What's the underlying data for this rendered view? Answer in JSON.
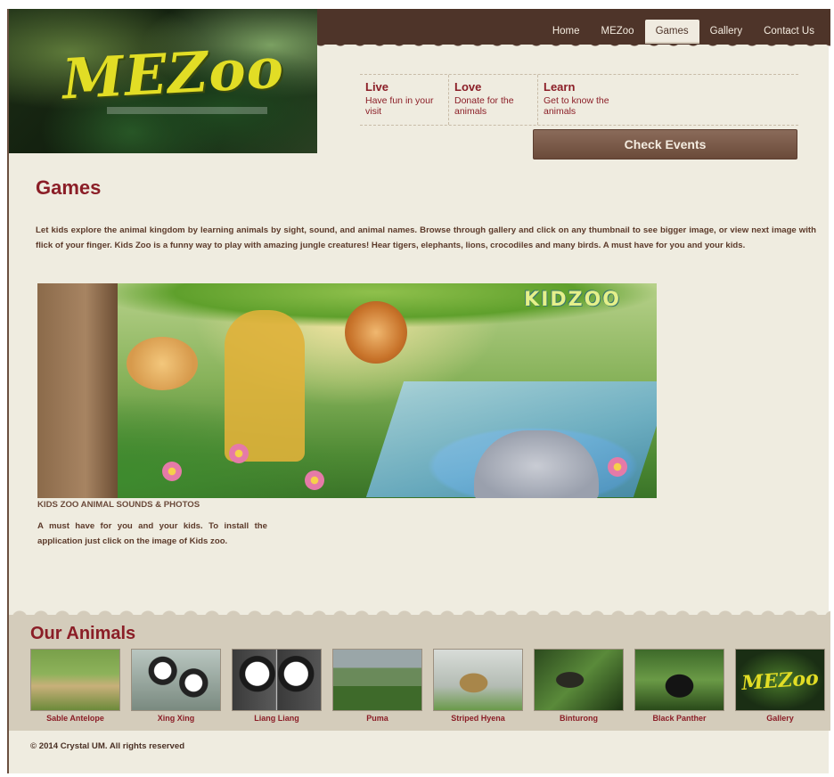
{
  "logo": {
    "text": "MEZoo"
  },
  "nav": {
    "items": [
      {
        "label": "Home",
        "active": false
      },
      {
        "label": "MEZoo",
        "active": false
      },
      {
        "label": "Games",
        "active": true
      },
      {
        "label": "Gallery",
        "active": false
      },
      {
        "label": "Contact Us",
        "active": false
      }
    ]
  },
  "promo": [
    {
      "title": "Live",
      "text": "Have fun in your visit"
    },
    {
      "title": "Love",
      "text": "Donate for the animals"
    },
    {
      "title": "Learn",
      "text": "Get to know the animals"
    }
  ],
  "check_events": "Check Events",
  "section_title": "Games",
  "intro": "Let kids explore the animal kingdom by learning animals by sight, sound, and animal names. Browse through gallery and click on any thumbnail to see bigger image, or view next image with flick of your finger. Kids Zoo is a funny way to play with amazing jungle creatures! Hear tigers, elephants, lions, crocodiles and many birds. A must have for you and your kids.",
  "banner": {
    "title": "KIDZOO",
    "caption": "KIDS ZOO ANIMAL SOUNDS & PHOTOS"
  },
  "side_text": "A must have for you and your kids. To install the application just click on the image of Kids zoo.",
  "animals": {
    "heading": "Our Animals",
    "items": [
      {
        "label": "Sable Antelope"
      },
      {
        "label": "Xing Xing"
      },
      {
        "label": "Liang Liang"
      },
      {
        "label": "Puma"
      },
      {
        "label": "Striped Hyena"
      },
      {
        "label": "Binturong"
      },
      {
        "label": "Black Panther"
      },
      {
        "label": "Gallery"
      }
    ]
  },
  "copyright": "© 2014 Crystal UM. All rights reserved",
  "colors": {
    "header": "#4e3429",
    "accent": "#8b1e27",
    "page_bg": "#efece0",
    "button": "#6b4a3a"
  }
}
